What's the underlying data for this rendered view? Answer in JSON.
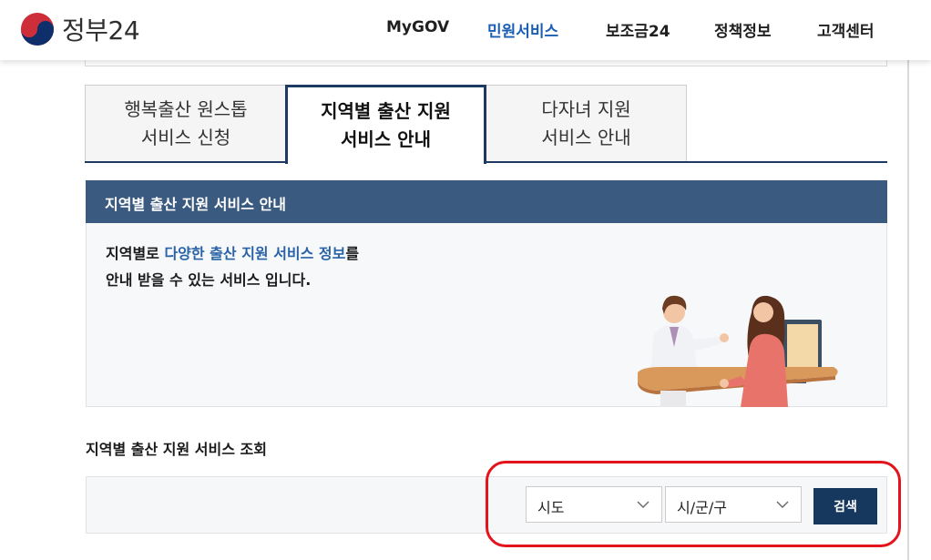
{
  "header": {
    "logo_text": "정부24",
    "nav": [
      "MyGOV",
      "민원서비스",
      "보조금24",
      "정책정보",
      "고객센터"
    ],
    "active_nav": "민원서비스",
    "active_color": "#1a5fb4"
  },
  "tabs": [
    {
      "line1": "행복출산 원스톱",
      "line2": "서비스 신청"
    },
    {
      "line1": "지역별 출산 지원",
      "line2": "서비스 안내"
    },
    {
      "line1": "다자녀 지원",
      "line2": "서비스 안내"
    }
  ],
  "active_tab": 1,
  "panel": {
    "title": "지역별 출산 지원 서비스 안내",
    "desc_line1_prefix": "지역별로 ",
    "desc_line1_highlight": "다양한 출산 지원 서비스 정보",
    "desc_line1_suffix": "를",
    "desc_line2": "안내 받을 수 있는 서비스 입니다.",
    "header_color": "#3b5a80",
    "highlight_color": "#2963a6"
  },
  "search": {
    "section_title": "지역별 출산 지원 서비스 조회",
    "sido_value": "시도",
    "sigungu_value": "시/군/구",
    "button_label": "검색",
    "button_color": "#16385e"
  },
  "annotation": {
    "color": "#e3141b"
  }
}
